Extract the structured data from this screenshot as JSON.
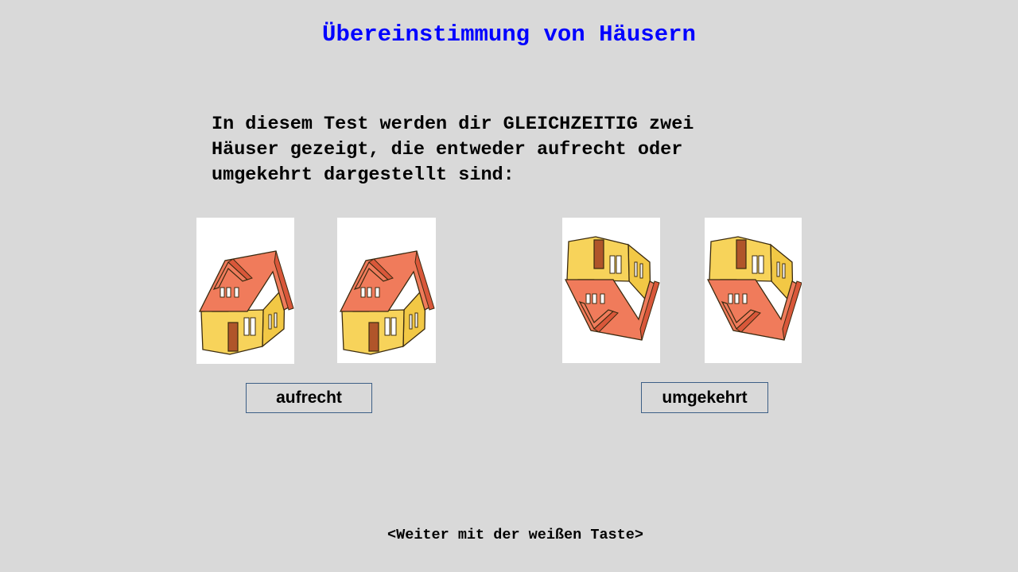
{
  "title": "Übereinstimmung von Häusern",
  "instructions": {
    "lines": [
      "In diesem Test werden dir GLEICHZEITIG zwei",
      "Häuser gezeigt, die entweder aufrecht oder",
      "umgekehrt dargestellt sind:"
    ]
  },
  "groups": {
    "upright": {
      "label": "aufrecht",
      "images": [
        "house-upright-icon",
        "house-upright-icon"
      ]
    },
    "inverted": {
      "label": "umgekehrt",
      "images": [
        "house-inverted-icon",
        "house-inverted-icon"
      ]
    }
  },
  "footer": "<Weiter mit der weißen Taste>",
  "colors": {
    "background": "#d9d9d9",
    "title": "#0000ff",
    "wall": "#f7d35a",
    "wall_side": "#f2c845",
    "roof": "#f07b5b",
    "roof_dark": "#d9573a",
    "door": "#b0552a",
    "label_border": "#3d5f86"
  }
}
